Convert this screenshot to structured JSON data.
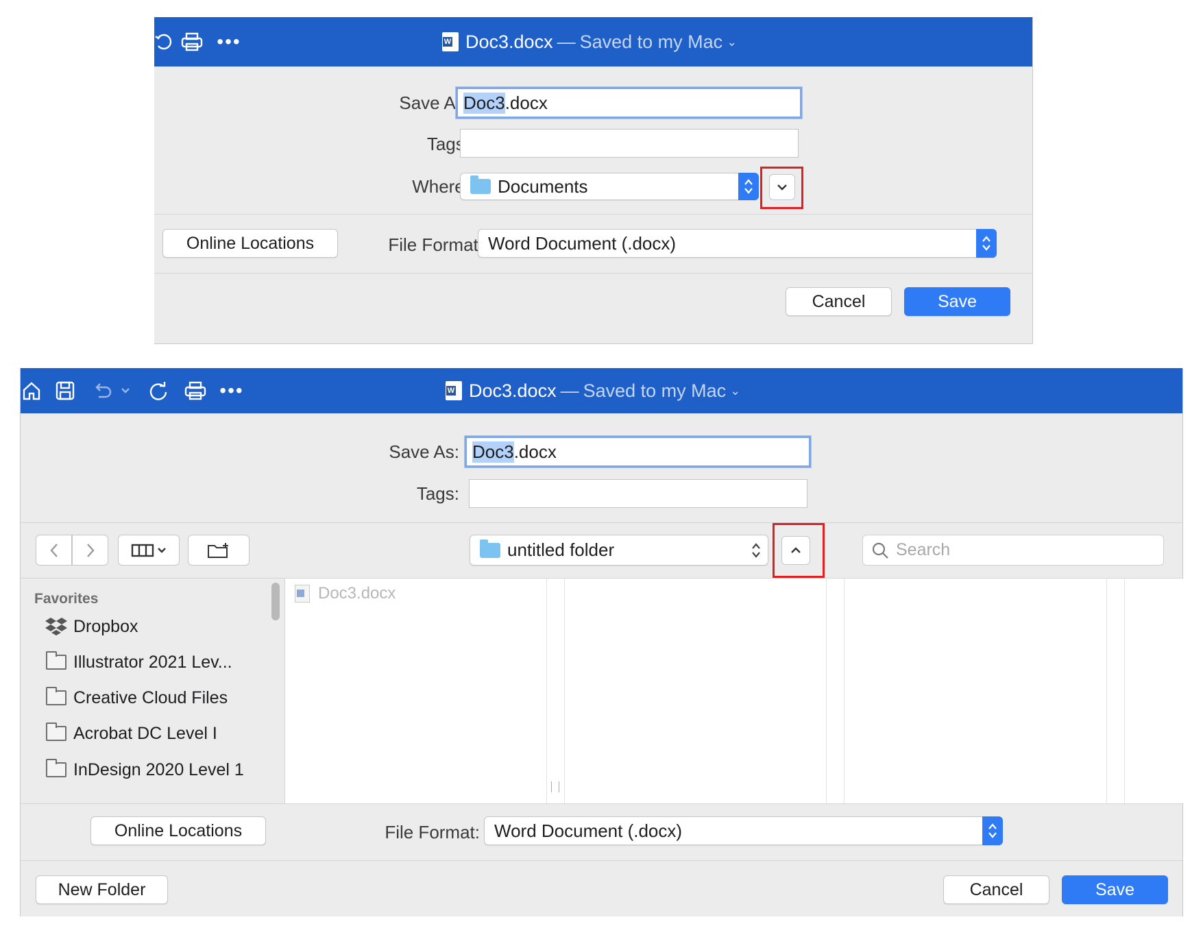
{
  "top_dialog": {
    "title": {
      "name": "Doc3.docx",
      "separator": "—",
      "location": "Saved to my Mac",
      "chevron": "⌄"
    },
    "toolbar_icons": [
      "refresh-icon",
      "print-icon",
      "more-icon"
    ],
    "save_as": {
      "label": "Save As:",
      "value_selected": "Doc3",
      "value_rest": ".docx"
    },
    "tags": {
      "label": "Tags:",
      "value": ""
    },
    "where": {
      "label": "Where:",
      "value": "Documents",
      "icon": "folder-icon"
    },
    "expand_button_icon": "chevron-down-icon",
    "online_locations": "Online Locations",
    "file_format": {
      "label": "File Format:",
      "value": "Word Document (.docx)"
    },
    "cancel": "Cancel",
    "save": "Save"
  },
  "bottom_dialog": {
    "title": {
      "name": "Doc3.docx",
      "separator": "—",
      "location": "Saved to my Mac",
      "chevron": "⌄"
    },
    "toolbar_icons": [
      "home-icon",
      "save-icon",
      "undo-icon",
      "refresh-icon",
      "print-icon",
      "more-icon"
    ],
    "save_as": {
      "label": "Save As:",
      "value_selected": "Doc3",
      "value_rest": ".docx"
    },
    "tags": {
      "label": "Tags:",
      "value": ""
    },
    "location_popup": {
      "value": "untitled folder",
      "icon": "folder-icon"
    },
    "collapse_button_icon": "chevron-up-icon",
    "search": {
      "placeholder": "Search"
    },
    "sidebar": {
      "heading": "Favorites",
      "items": [
        {
          "label": "Dropbox",
          "icon": "dropbox-icon"
        },
        {
          "label": "Illustrator 2021 Lev...",
          "icon": "folder-icon"
        },
        {
          "label": "Creative Cloud Files",
          "icon": "folder-icon"
        },
        {
          "label": "Acrobat DC Level I",
          "icon": "folder-icon"
        },
        {
          "label": "InDesign 2020 Level 1",
          "icon": "folder-icon"
        }
      ]
    },
    "files": [
      {
        "name": "Doc3.docx",
        "icon": "word-doc-icon",
        "dimmed": true
      }
    ],
    "online_locations": "Online Locations",
    "file_format": {
      "label": "File Format:",
      "value": "Word Document (.docx)"
    },
    "new_folder": "New Folder",
    "cancel": "Cancel",
    "save": "Save"
  },
  "colors": {
    "titlebar": "#1f5fc8",
    "accent": "#2f7bf5",
    "highlight_box": "#e02020",
    "panel": "#ececec"
  }
}
